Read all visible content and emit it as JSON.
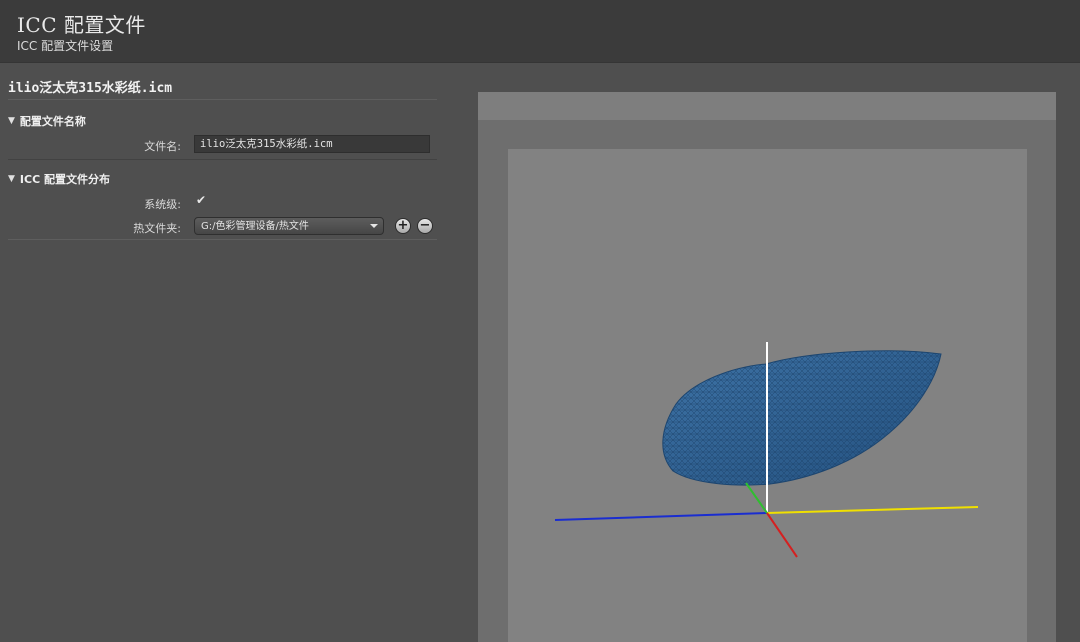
{
  "header": {
    "title": "ICC 配置文件",
    "subtitle": "ICC 配置文件设置"
  },
  "profile": {
    "file_title": "ilio泛太克315水彩纸.icm"
  },
  "sections": {
    "name": {
      "heading": "配置文件名称",
      "filename_label": "文件名:",
      "filename_value": "ilio泛太克315水彩纸.icm"
    },
    "distribution": {
      "heading": "ICC 配置文件分布",
      "system_label": "系统级:",
      "system_checked": true,
      "hot_folder_label": "热文件夹:",
      "hot_folder_value": "G:/色彩管理设备/热文件",
      "add_label": "+",
      "remove_label": "−"
    }
  },
  "viewer": {
    "axis_colors": {
      "vertical": "#ffffff",
      "x_axis": "#f0e000",
      "z_axis": "#1a2dd0",
      "y_green": "#2fbf2f",
      "y_red": "#d42020"
    },
    "gamut_color": "#2b5d8f",
    "icon_names": [
      "expand-triangle-icon",
      "check-icon",
      "dropdown-arrow-icon",
      "plus-icon",
      "minus-icon"
    ]
  }
}
